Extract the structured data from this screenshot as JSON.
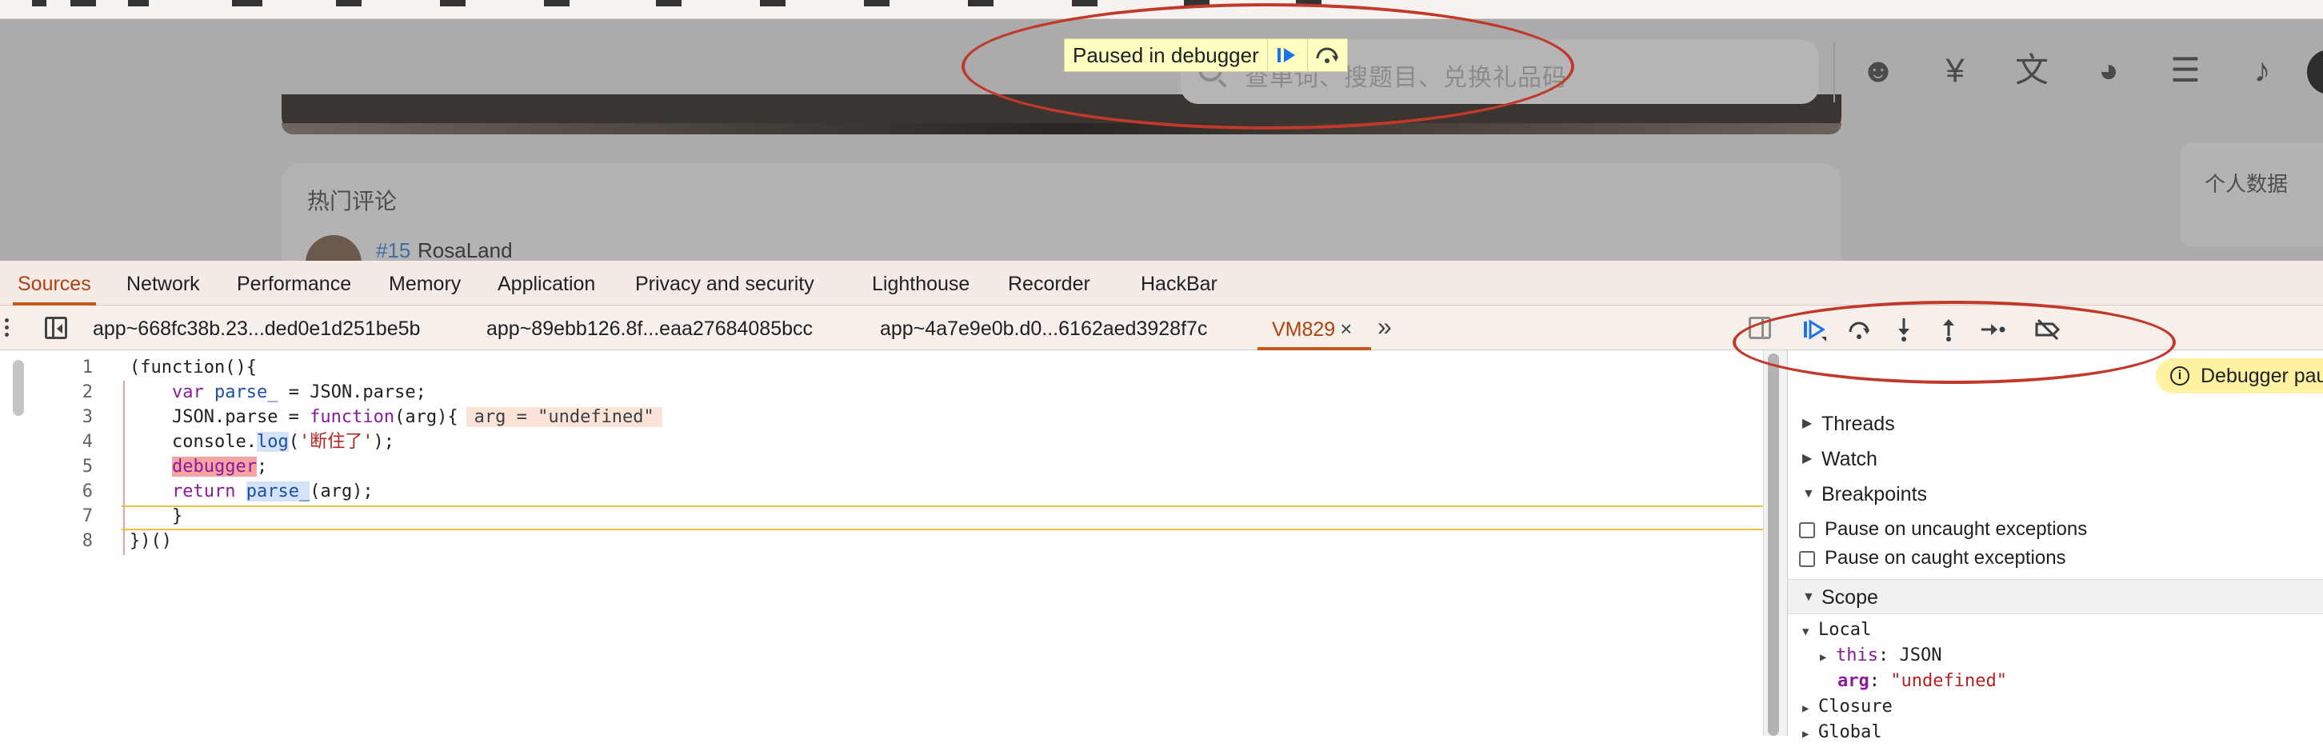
{
  "page": {
    "search_placeholder": "查单词、搜题目、兑换礼品码",
    "paused_label": "Paused in debugger",
    "comments_title": "热门评论",
    "comment_user_num": "#15",
    "comment_user_name": "RosaLand",
    "side_card_title": "个人数据",
    "nav_icons": [
      "kid-face-icon",
      "yuan-icon",
      "translate-icon",
      "palette-icon",
      "message-icon",
      "bell-icon"
    ],
    "nav_glyphs": [
      "☻",
      "¥",
      "文",
      "◕",
      "☰",
      "♪"
    ]
  },
  "devtools": {
    "tabs": [
      "Sources",
      "Network",
      "Performance",
      "Memory",
      "Application",
      "Privacy and security",
      "Lighthouse",
      "Recorder",
      "HackBar"
    ],
    "active_tab": "Sources",
    "files": [
      "app~668fc38b.23...ded0e1d251be5b",
      "app~89ebb126.8f...eaa27684085bcc",
      "app~4a7e9e0b.d0...6162aed3928f7c",
      "VM829"
    ],
    "active_file": "VM829",
    "close_glyph": "×",
    "more_glyph": "»",
    "code": {
      "line_numbers": [
        "1",
        "2",
        "3",
        "4",
        "5",
        "6",
        "7",
        "8"
      ],
      "l1": "(function(){",
      "l2_kw": "var",
      "l2_name": "parse_",
      "l2_rest": " = JSON.parse;",
      "l3_a": "JSON.parse = ",
      "l3_kw": "function",
      "l3_b": "(arg){",
      "l3_inline": "arg = \"undefined\"",
      "l4_a": "console.",
      "l4_fn": "log",
      "l4_b": "(",
      "l4_str": "'断住了'",
      "l4_c": ");",
      "l5_kw": "debugger",
      "l5_rest": ";",
      "l6_kw": "return",
      "l6_name": "parse_",
      "l6_rest": "(arg);",
      "l7": "}",
      "l8": "})()"
    },
    "panel": {
      "banner": "Debugger paused",
      "sections": [
        "Threads",
        "Watch",
        "Breakpoints"
      ],
      "checkboxes": [
        "Pause on uncaught exceptions",
        "Pause on caught exceptions"
      ],
      "scope": "Scope",
      "local": "Local",
      "this_key": "this",
      "this_val": "JSON",
      "arg_key": "arg",
      "arg_val": "\"undefined\"",
      "closure": "Closure",
      "global": "Global"
    }
  },
  "colors": {
    "accent": "#c45a1b",
    "annotation": "#c0392b",
    "paused_bg": "#ffffc2",
    "banner_bg": "#fff3a3"
  }
}
